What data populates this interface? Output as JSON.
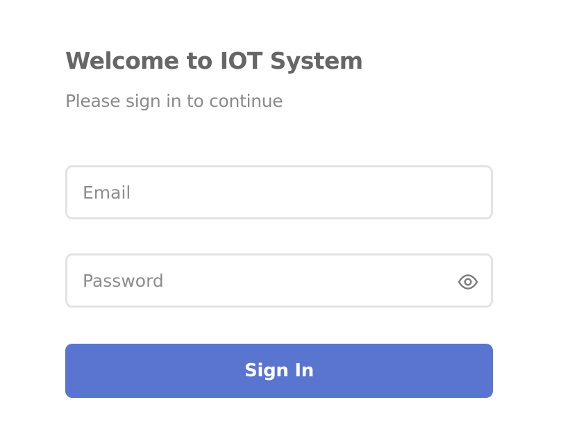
{
  "header": {
    "title": "Welcome to IOT System",
    "subtitle": "Please sign in to continue"
  },
  "form": {
    "email": {
      "placeholder": "Email",
      "value": ""
    },
    "password": {
      "placeholder": "Password",
      "value": "",
      "toggle_icon": "eye-icon"
    },
    "submit_label": "Sign In"
  },
  "colors": {
    "accent": "#5a75cf",
    "title_text": "#666666",
    "subtitle_text": "#8a8a8a",
    "field_border": "#e3e3e3",
    "placeholder_text": "#8d8d8d"
  }
}
